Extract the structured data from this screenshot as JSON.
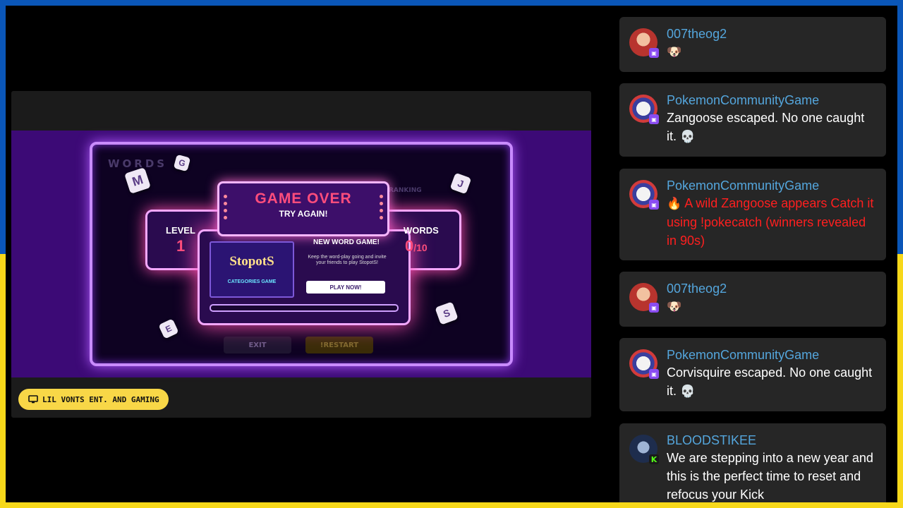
{
  "colors": {
    "top_band": "#0a56b8",
    "bottom_band": "#f7d81a",
    "player_bg": "#1b1b1b",
    "game_bg": "#3c0a76",
    "username": "#54a6dd",
    "alert_red": "#ff1f1f",
    "badge": "#f8d747"
  },
  "game": {
    "title": "GAME OVER",
    "subtitle": "TRY AGAIN!",
    "level_label": "LEVEL",
    "level_value": "1",
    "words_label": "WORDS",
    "words_value": "0",
    "words_total": "/10",
    "promo_logo": "StopotS",
    "promo_category": "CATEGORIES GAME",
    "promo_title": "NEW WORD GAME!",
    "promo_text": "Keep the word-play going and invite your friends to play StopotS!",
    "play_now": "PLAY NOW!",
    "bg_logo": "WORDS",
    "bg_ranking": "RANKING",
    "bg_exit": "EXIT",
    "bg_restart": "!RESTART",
    "dice": [
      "M",
      "G",
      "J",
      "S",
      "E"
    ]
  },
  "channel": {
    "icon": "monitor-icon",
    "name": "LIL VONTS ENT. AND GAMING"
  },
  "chat": [
    {
      "user": "007theog2",
      "text": "",
      "emoji": "🐶",
      "platform": "twitch"
    },
    {
      "user": "PokemonCommunityGame",
      "text": "Zangoose escaped. No one caught it.",
      "emoji": "💀",
      "platform": "twitch"
    },
    {
      "user": "PokemonCommunityGame",
      "text": "A wild Zangoose appears Catch it using !pokecatch (winners revealed in 90s)",
      "emoji": "🔥",
      "platform": "twitch",
      "style": "alert"
    },
    {
      "user": "007theog2",
      "text": "",
      "emoji": "🐶",
      "platform": "twitch"
    },
    {
      "user": "PokemonCommunityGame",
      "text": "Corvisquire escaped. No one caught it.",
      "emoji": "💀",
      "platform": "twitch"
    },
    {
      "user": "BLOODSTIKEE",
      "text": "We are stepping into a new year and this is the perfect time to reset and refocus your Kick",
      "emoji": "",
      "platform": "kick"
    }
  ]
}
